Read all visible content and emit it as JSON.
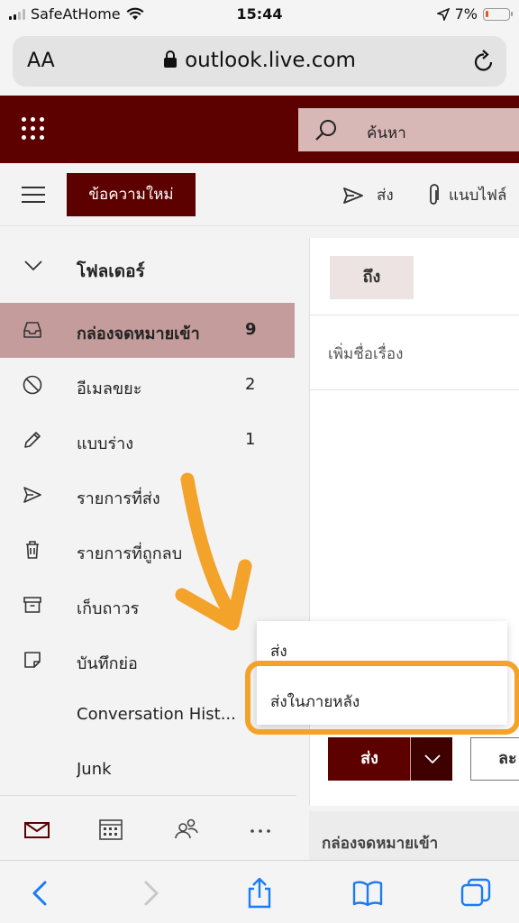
{
  "status_bar": {
    "carrier": "SafeAtHome",
    "time": "15:44",
    "battery": "7%"
  },
  "browser": {
    "text_size": "AA",
    "url": "outlook.live.com"
  },
  "header": {
    "search_placeholder": "ค้นหา"
  },
  "toolbar": {
    "new_message": "ข้อความใหม่",
    "send": "ส่ง",
    "attach": "แนบไฟล์"
  },
  "folders": {
    "heading": "โฟลเดอร์",
    "items": [
      {
        "label": "กล่องจดหมายเข้า",
        "count": "9",
        "icon": "inbox-icon"
      },
      {
        "label": "อีเมลขยะ",
        "count": "2",
        "icon": "junk-icon"
      },
      {
        "label": "แบบร่าง",
        "count": "1",
        "icon": "pencil-icon"
      },
      {
        "label": "รายการที่ส่ง",
        "count": "",
        "icon": "send-icon"
      },
      {
        "label": "รายการที่ถูกลบ",
        "count": "",
        "icon": "trash-icon"
      },
      {
        "label": "เก็บถาวร",
        "count": "",
        "icon": "archive-icon"
      },
      {
        "label": "บันทึกย่อ",
        "count": "",
        "icon": "note-icon"
      },
      {
        "label": "Conversation Hist...",
        "count": "",
        "icon": ""
      },
      {
        "label": "Junk",
        "count": "",
        "icon": ""
      }
    ]
  },
  "compose": {
    "to_label": "ถึง",
    "subject_placeholder": "เพิ่มชื่อเรื่อง",
    "send_label": "ส่ง",
    "discard_label": "ละ"
  },
  "send_menu": {
    "option_send": "ส่ง",
    "option_send_later": "ส่งในภายหลัง"
  },
  "inbox_bar": {
    "label": "กล่องจดหมายเข้า"
  },
  "colors": {
    "brand": "#5d0000",
    "selected": "#c49c9c",
    "annotation": "#f3a22a",
    "safari_blue": "#1a7cf5"
  }
}
